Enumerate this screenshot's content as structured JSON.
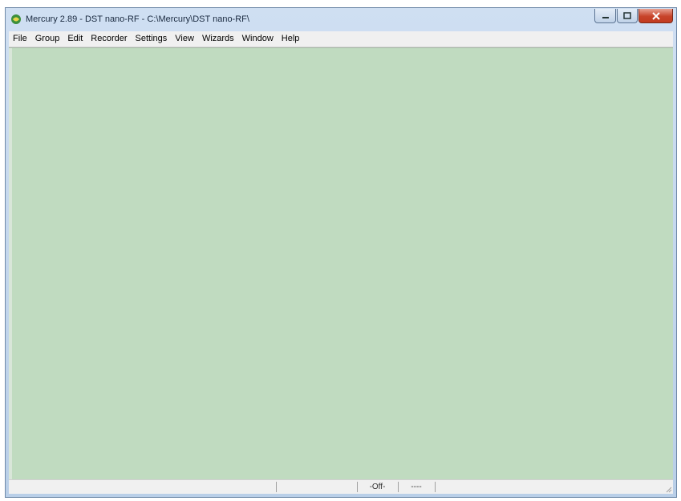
{
  "window": {
    "title": "Mercury 2.89 - DST nano-RF - C:\\Mercury\\DST nano-RF\\",
    "icon": "mercury-app-icon",
    "controls": [
      "minimize-icon",
      "maximize-icon",
      "close-icon"
    ]
  },
  "menu": {
    "items": [
      "File",
      "Group",
      "Edit",
      "Recorder",
      "Settings",
      "View",
      "Wizards",
      "Window",
      "Help"
    ]
  },
  "workspace": {
    "background": "#c0dbc0"
  },
  "statusbar": {
    "pane1": "",
    "pane2": "",
    "pane3": "-Off-",
    "pane4": "----",
    "pane5": ""
  }
}
